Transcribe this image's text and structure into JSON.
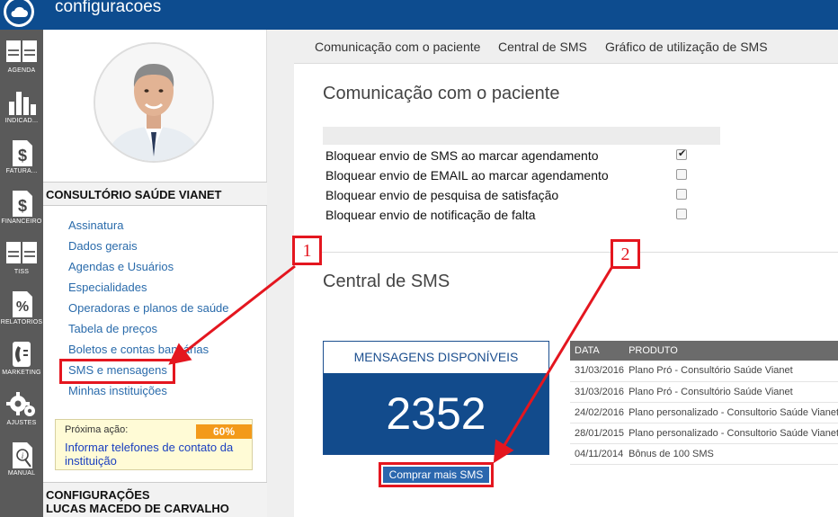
{
  "app": {
    "title": "configuracoes"
  },
  "rail": [
    {
      "label": "AGENDA",
      "icon": "calendar-icon"
    },
    {
      "label": "INDICAD...",
      "icon": "bar-chart-icon"
    },
    {
      "label": "FATURA...",
      "icon": "dollar-doc-icon"
    },
    {
      "label": "FINANCEIRO",
      "icon": "dollar-doc-icon"
    },
    {
      "label": "TISS",
      "icon": "calendar-icon"
    },
    {
      "label": "RELATÓRIOS",
      "icon": "percent-doc-icon"
    },
    {
      "label": "MARKETING",
      "icon": "phone-icon"
    },
    {
      "label": "AJUSTES",
      "icon": "gears-icon"
    },
    {
      "label": "MANUAL",
      "icon": "manual-icon"
    }
  ],
  "sidebar": {
    "clinic_name": "CONSULTÓRIO SAÚDE VIANET",
    "menu": [
      "Assinatura",
      "Dados gerais",
      "Agendas e Usuários",
      "Especialidades",
      "Operadoras e planos de saúde",
      "Tabela de preços",
      "Boletos e contas bancárias",
      "SMS e mensagens",
      "Minhas instituições"
    ],
    "next_action": {
      "label": "Próxima ação:",
      "percent": "60%",
      "link": "Informar telefones de contato da instituição"
    },
    "config_title": "CONFIGURAÇÕES",
    "user_name": "LUCAS MACEDO DE CARVALHO"
  },
  "tabs": [
    "Comunicação com o paciente",
    "Central de SMS",
    "Gráfico de utilização de SMS"
  ],
  "communication": {
    "title": "Comunicação com o paciente",
    "options": [
      {
        "label": "Bloquear envio de SMS ao marcar agendamento",
        "checked": true
      },
      {
        "label": "Bloquear envio de EMAIL ao marcar agendamento",
        "checked": false
      },
      {
        "label": "Bloquear envio de pesquisa de satisfação",
        "checked": false
      },
      {
        "label": "Bloquear envio de notificação de falta",
        "checked": false
      }
    ]
  },
  "sms_center": {
    "title": "Central de SMS",
    "available_label": "MENSAGENS DISPONÍVEIS",
    "available_count": "2352",
    "buy_button": "Comprar mais SMS",
    "table": {
      "headers": [
        "DATA",
        "PRODUTO"
      ],
      "rows": [
        [
          "31/03/2016",
          "Plano Pró - Consultório Saúde Vianet"
        ],
        [
          "31/03/2016",
          "Plano Pró - Consultório Saúde Vianet"
        ],
        [
          "24/02/2016",
          "Plano personalizado - Consultorio Saúde Vianet"
        ],
        [
          "28/01/2015",
          "Plano personalizado - Consultorio Saúde Vianet"
        ],
        [
          "04/11/2014",
          "Bônus de 100 SMS"
        ]
      ]
    }
  },
  "annotations": {
    "marker_1": "1",
    "marker_2": "2",
    "color": "#e4161f"
  },
  "colors": {
    "topbar": "#0d4c8f",
    "rail": "#5a5a5a",
    "link": "#2a6bab",
    "counter_bg": "#124b8c",
    "progress": "#f39a1a"
  }
}
